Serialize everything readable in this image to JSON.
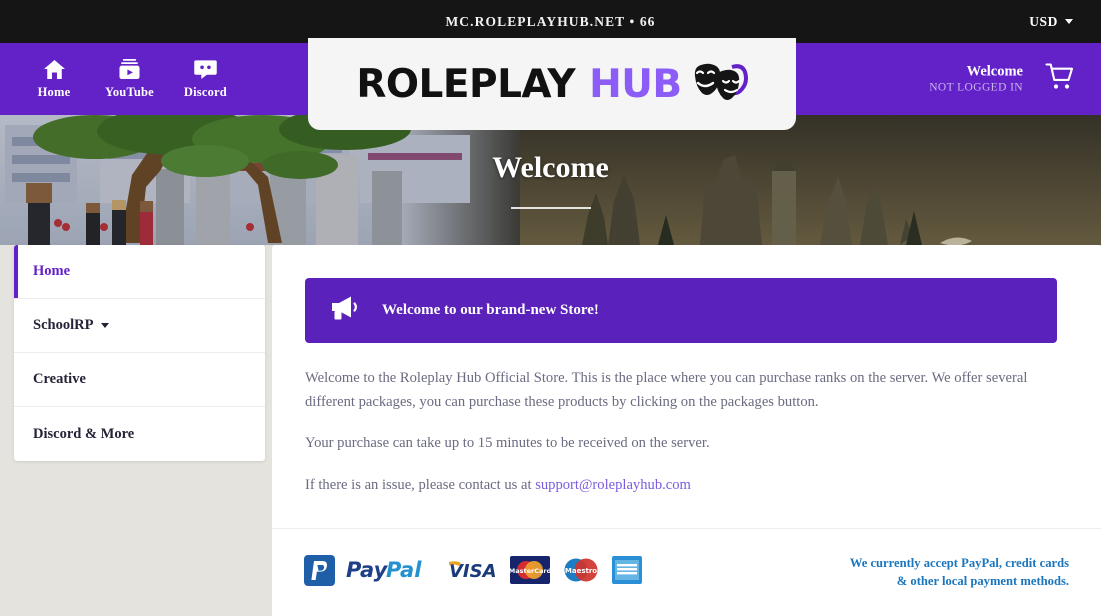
{
  "topbar": {
    "server_address": "MC.ROLEPLAYHUB.NET  •  66",
    "currency": "USD",
    "currency_icon": "chevron-down-icon",
    "background": "#151515"
  },
  "navbar": {
    "background": "#6321c8",
    "items": [
      {
        "label": "Home",
        "icon": "home-icon"
      },
      {
        "label": "YouTube",
        "icon": "youtube-icon"
      },
      {
        "label": "Discord",
        "icon": "discord-icon"
      }
    ],
    "account": {
      "title": "Welcome",
      "subtitle": "NOT LOGGED IN"
    },
    "cart_icon": "shopping-cart-icon"
  },
  "logo": {
    "word_dark": "ROLEPLAY",
    "word_accent": "HUB",
    "accent_color": "#8b5cf6",
    "mark_icon": "theater-masks-icon"
  },
  "hero": {
    "title": "Welcome",
    "scene": "minecraft-roleplay-banner"
  },
  "sidebar": {
    "items": [
      {
        "label": "Home",
        "active": true,
        "has_dropdown": false
      },
      {
        "label": "SchoolRP",
        "active": false,
        "has_dropdown": true
      },
      {
        "label": "Creative",
        "active": false,
        "has_dropdown": false
      },
      {
        "label": "Discord & More",
        "active": false,
        "has_dropdown": false
      }
    ]
  },
  "main": {
    "announcement": {
      "icon": "megaphone-icon",
      "text": "Welcome to our brand-new Store!",
      "background": "#5b21bb"
    },
    "paragraphs": {
      "p1": "Welcome to the Roleplay Hub Official Store. This is the place where you can purchase ranks on the server. We offer several different packages, you can purchase these products by clicking on the packages button.",
      "p2": "Your purchase can take up to 15 minutes to be received on the server.",
      "p3_prefix": "If there is an issue, please contact us at ",
      "p3_link": "support@roleplayhub.com"
    }
  },
  "footer": {
    "payment_methods": [
      {
        "name": "paypal-mark-icon"
      },
      {
        "name": "paypal-wordmark-icon"
      },
      {
        "name": "visa-icon"
      },
      {
        "name": "mastercard-icon"
      },
      {
        "name": "maestro-icon"
      },
      {
        "name": "american-express-icon"
      }
    ],
    "note_line1": "We currently accept PayPal, credit cards",
    "note_line2": "& other local payment methods.",
    "note_color": "#1a76bd"
  }
}
